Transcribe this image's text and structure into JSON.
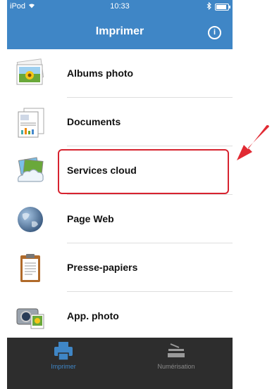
{
  "status_bar": {
    "carrier": "iPod",
    "time": "10:33",
    "battery_level": 0.85
  },
  "nav": {
    "title": "Imprimer",
    "info_icon": "info-icon",
    "info_glyph": "i"
  },
  "menu": {
    "items": [
      {
        "label": "Albums photo",
        "icon": "photo-album-icon"
      },
      {
        "label": "Documents",
        "icon": "documents-icon"
      },
      {
        "label": "Services cloud",
        "icon": "cloud-services-icon"
      },
      {
        "label": "Page Web",
        "icon": "globe-icon"
      },
      {
        "label": "Presse-papiers",
        "icon": "clipboard-icon"
      },
      {
        "label": "App. photo",
        "icon": "camera-icon"
      }
    ]
  },
  "tabs": [
    {
      "label": "Imprimer",
      "icon": "printer-icon",
      "active": true
    },
    {
      "label": "Numérisation",
      "icon": "scanner-icon",
      "active": false
    }
  ],
  "colors": {
    "accent": "#3f86c6",
    "tabbar": "#2d2d2d",
    "highlight": "#d7232f"
  },
  "annotation": {
    "highlighted_item": "Services cloud"
  }
}
